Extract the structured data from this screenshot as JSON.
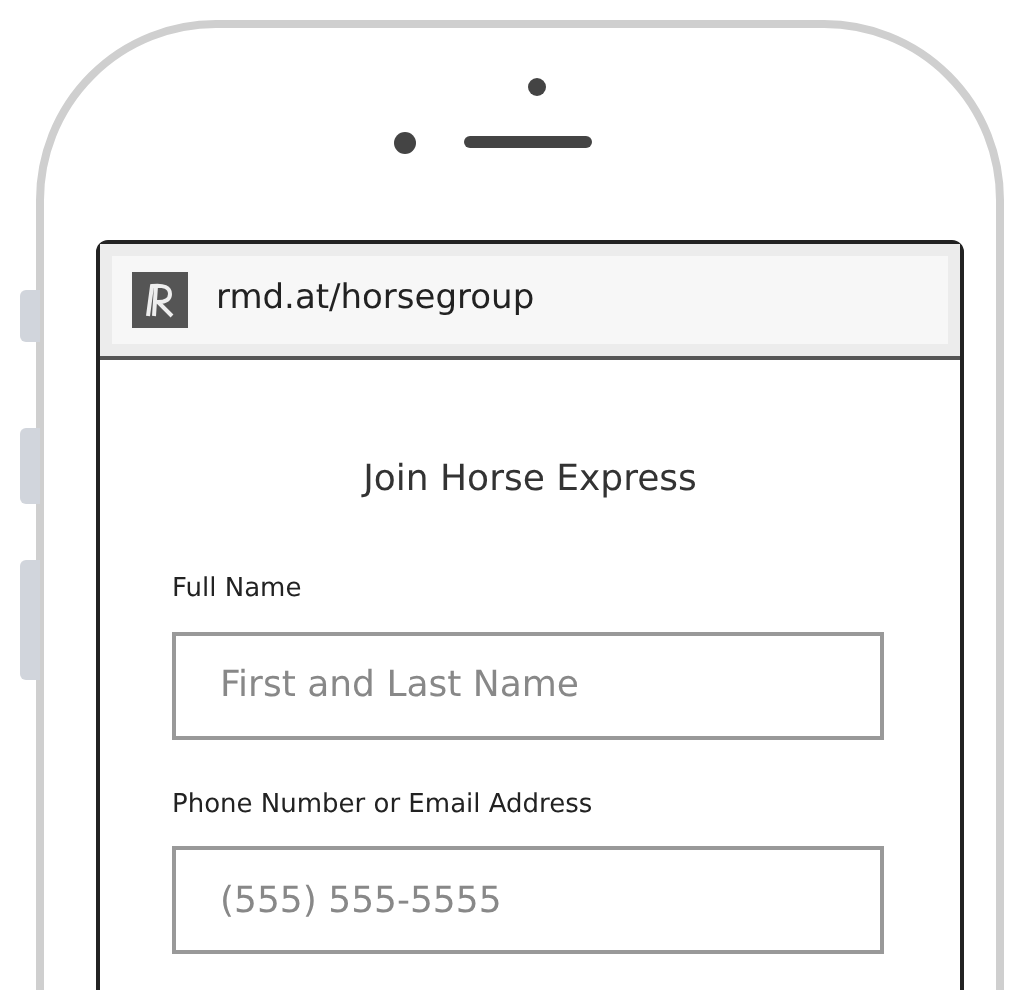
{
  "browser": {
    "url": "rmd.at/horsegroup"
  },
  "page": {
    "title": "Join Horse Express",
    "fields": [
      {
        "label": "Full Name",
        "placeholder": "First and Last Name"
      },
      {
        "label": "Phone Number or Email Address",
        "placeholder": "(555) 555-5555"
      }
    ]
  }
}
